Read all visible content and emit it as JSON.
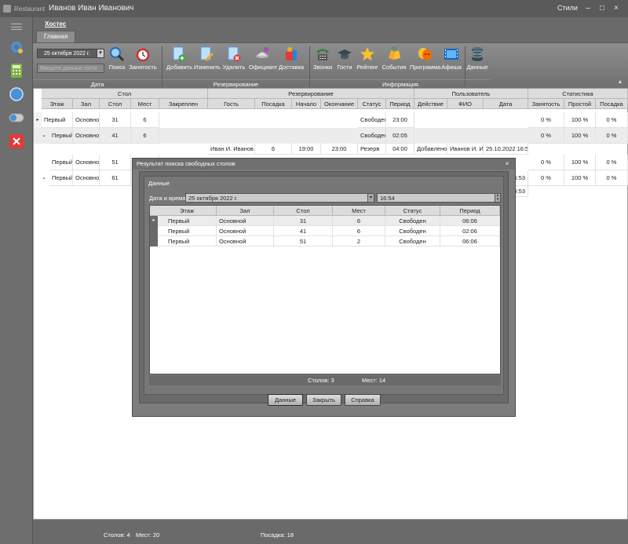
{
  "window": {
    "app": "Restaurant",
    "user": "Иванов Иван Иванович",
    "styles": "Стили",
    "min": "–",
    "max": "□",
    "close": "×"
  },
  "tabs": {
    "top": "Хостес",
    "sub": "Главная"
  },
  "ribbon": {
    "date_value": "25 октября 2022 г.",
    "guest_placeholder": "Введите данные гостя",
    "buttons": {
      "search": "Поиск",
      "busy": "Занятость",
      "add": "Добавить",
      "edit": "Изменить",
      "delete": "Удалить",
      "waiter": "Официант",
      "delivery": "Доставка",
      "calls": "Звонки",
      "guests": "Гости",
      "rating": "Рейтинг",
      "events": "События",
      "program": "Программа",
      "poster": "Афиша",
      "data": "Данные"
    },
    "groups": {
      "date": "Дата",
      "reservation": "Резервирование",
      "info": "Информация"
    }
  },
  "grid": {
    "bands": {
      "table": "Стол",
      "reservation": "Резервирование",
      "user": "Пользователь",
      "stats": "Статистика"
    },
    "cols": {
      "floor": "Этаж",
      "hall": "Зал",
      "table": "Стол",
      "seats": "Мест",
      "assigned": "Закреплен",
      "guest": "Гость",
      "seating": "Посадка",
      "start": "Начало",
      "end": "Окончание",
      "status": "Статус",
      "period": "Период",
      "action": "Действие",
      "fio": "ФИО",
      "date": "Дата",
      "occupancy": "Занятость",
      "idle": "Простой",
      "seat_pct": "Посадка"
    },
    "rows": [
      {
        "floor": "Первый",
        "hall": "Основной",
        "table": "31",
        "seats": "6",
        "status": "Свободен",
        "period": "23:00",
        "occ": "0 %",
        "idle": "100 %",
        "seat": "0 %"
      },
      {
        "floor": "Первый",
        "hall": "Основной",
        "table": "41",
        "seats": "6",
        "status": "Свободен",
        "period": "02:05",
        "occ": "0 %",
        "idle": "100 %",
        "seat": "0 %"
      },
      {
        "guest": "Иван И. Иванов",
        "seating": "6",
        "start": "19:00",
        "end": "23:00",
        "status": "Резерв",
        "period": "04:00",
        "action": "Добавлено",
        "fio": "Иванов И. И.",
        "date": "25.10.2022 16:53"
      },
      {
        "floor": "Первый",
        "hall": "Основной",
        "table": "51",
        "seats": "2",
        "occ": "0 %",
        "idle": "100 %",
        "seat": "0 %"
      },
      {
        "floor": "Первый",
        "hall": "Основной",
        "table": "61",
        "seats": "4",
        "date": "16:53",
        "occ": "0 %",
        "idle": "100 %",
        "seat": "0 %"
      },
      {
        "date": "16:53"
      }
    ]
  },
  "status": {
    "tables": "Столов: 4",
    "seats": "Мест: 20",
    "seating": "Посадка: 18"
  },
  "dialog": {
    "title": "Результат поиска свободных столов",
    "close": "×",
    "group": "Данные",
    "dt_label": "Дата и время:",
    "date": "25 октября 2022 г.",
    "time": "16:54",
    "cols": {
      "floor": "Этаж",
      "hall": "Зал",
      "table": "Стол",
      "seats": "Мест",
      "status": "Статус",
      "period": "Период"
    },
    "rows": [
      {
        "floor": "Первый",
        "hall": "Основной",
        "table": "31",
        "seats": "6",
        "status": "Свободен",
        "period": "06:06"
      },
      {
        "floor": "Первый",
        "hall": "Основной",
        "table": "41",
        "seats": "6",
        "status": "Свободен",
        "period": "02:06"
      },
      {
        "floor": "Первый",
        "hall": "Основной",
        "table": "51",
        "seats": "2",
        "status": "Свободен",
        "period": "06:06"
      }
    ],
    "footer": {
      "tables": "Столов: 3",
      "seats": "Мест: 14"
    },
    "buttons": {
      "data": "Данные",
      "close": "Закрыть",
      "help": "Справка"
    }
  }
}
